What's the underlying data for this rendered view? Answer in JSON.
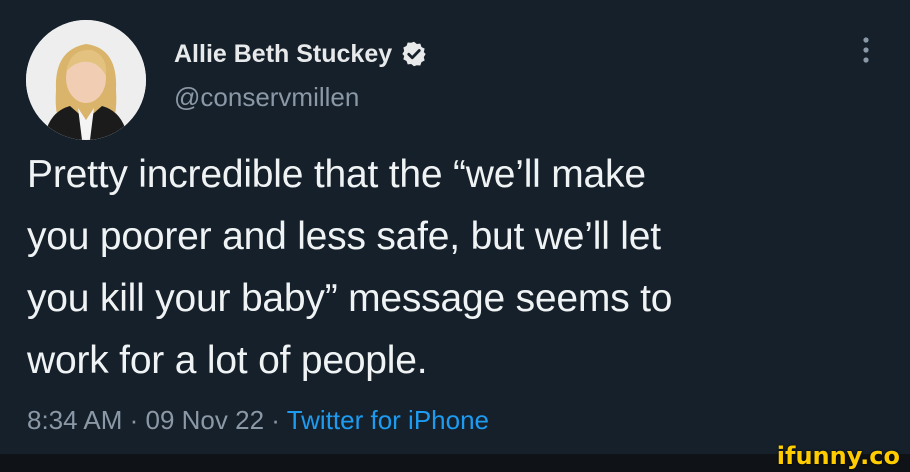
{
  "author": {
    "name": "Allie Beth Stuckey",
    "handle": "@conservmillen",
    "avatar_icon": "profile-photo",
    "verified_icon": "verified-badge-icon"
  },
  "menu_icon": "more-vertical-icon",
  "tweet": {
    "lines": [
      "Pretty incredible that the “we’ll make",
      "you poorer and less safe, but we’ll let",
      "you kill your baby” message seems to",
      "work for a lot of people."
    ]
  },
  "meta": {
    "time": "8:34 AM",
    "date": "09 Nov 22",
    "separator": " · ",
    "source": "Twitter for iPhone"
  },
  "watermark": "ifunny.co",
  "colors": {
    "background": "#15202b",
    "text": "#e7e9ea",
    "secondary": "#8b98a5",
    "link": "#1d9bf0",
    "watermark": "#ffcc00"
  }
}
